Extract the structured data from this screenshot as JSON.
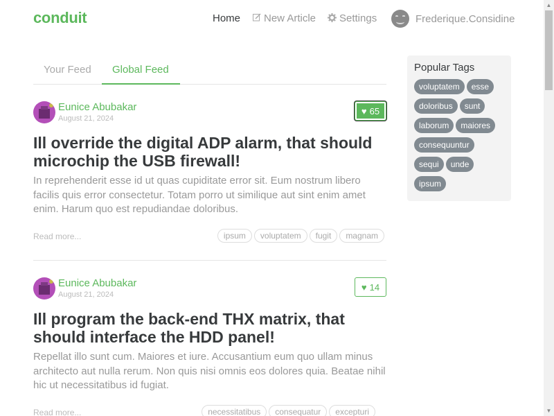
{
  "navbar": {
    "brand": "conduit",
    "home": "Home",
    "new_article": "New Article",
    "settings": "Settings",
    "username": "Frederique.Considine",
    "icons": {
      "new_article": "compose-icon",
      "settings": "gear-icon",
      "user": "smiley-avatar"
    }
  },
  "tabs": {
    "your_feed": "Your Feed",
    "global_feed": "Global Feed"
  },
  "articles": [
    {
      "author": "Eunice Abubakar",
      "date": "August 21, 2024",
      "likes": "65",
      "favorited": true,
      "title": "Ill override the digital ADP alarm, that should microchip the USB firewall!",
      "preview": "In reprehenderit esse id ut quas cupiditate error sit. Eum nostrum libero facilis quis error consectetur. Totam porro ut similique aut sint enim amet enim. Harum quo est repudiandae doloribus.",
      "read_more": "Read more...",
      "tags": [
        "ipsum",
        "voluptatem",
        "fugit",
        "magnam"
      ]
    },
    {
      "author": "Eunice Abubakar",
      "date": "August 21, 2024",
      "likes": "14",
      "favorited": false,
      "title": "Ill program the back-end THX matrix, that should interface the HDD panel!",
      "preview": "Repellat illo sunt cum. Maiores et iure. Accusantium eum quo ullam minus architecto aut nulla rerum. Non quis nisi omnis eos dolores quia. Beatae nihil hic ut necessitatibus id fugiat.",
      "read_more": "Read more...",
      "tags": [
        "necessitatibus",
        "consequatur",
        "excepturi"
      ]
    }
  ],
  "sidebar": {
    "title": "Popular Tags",
    "tags": [
      "voluptatem",
      "esse",
      "doloribus",
      "sunt",
      "laborum",
      "maiores",
      "consequuntur",
      "sequi",
      "unde",
      "ipsum"
    ]
  },
  "colors": {
    "brand": "#5cb85c",
    "tag_pill": "#818a91",
    "muted": "#999999"
  }
}
